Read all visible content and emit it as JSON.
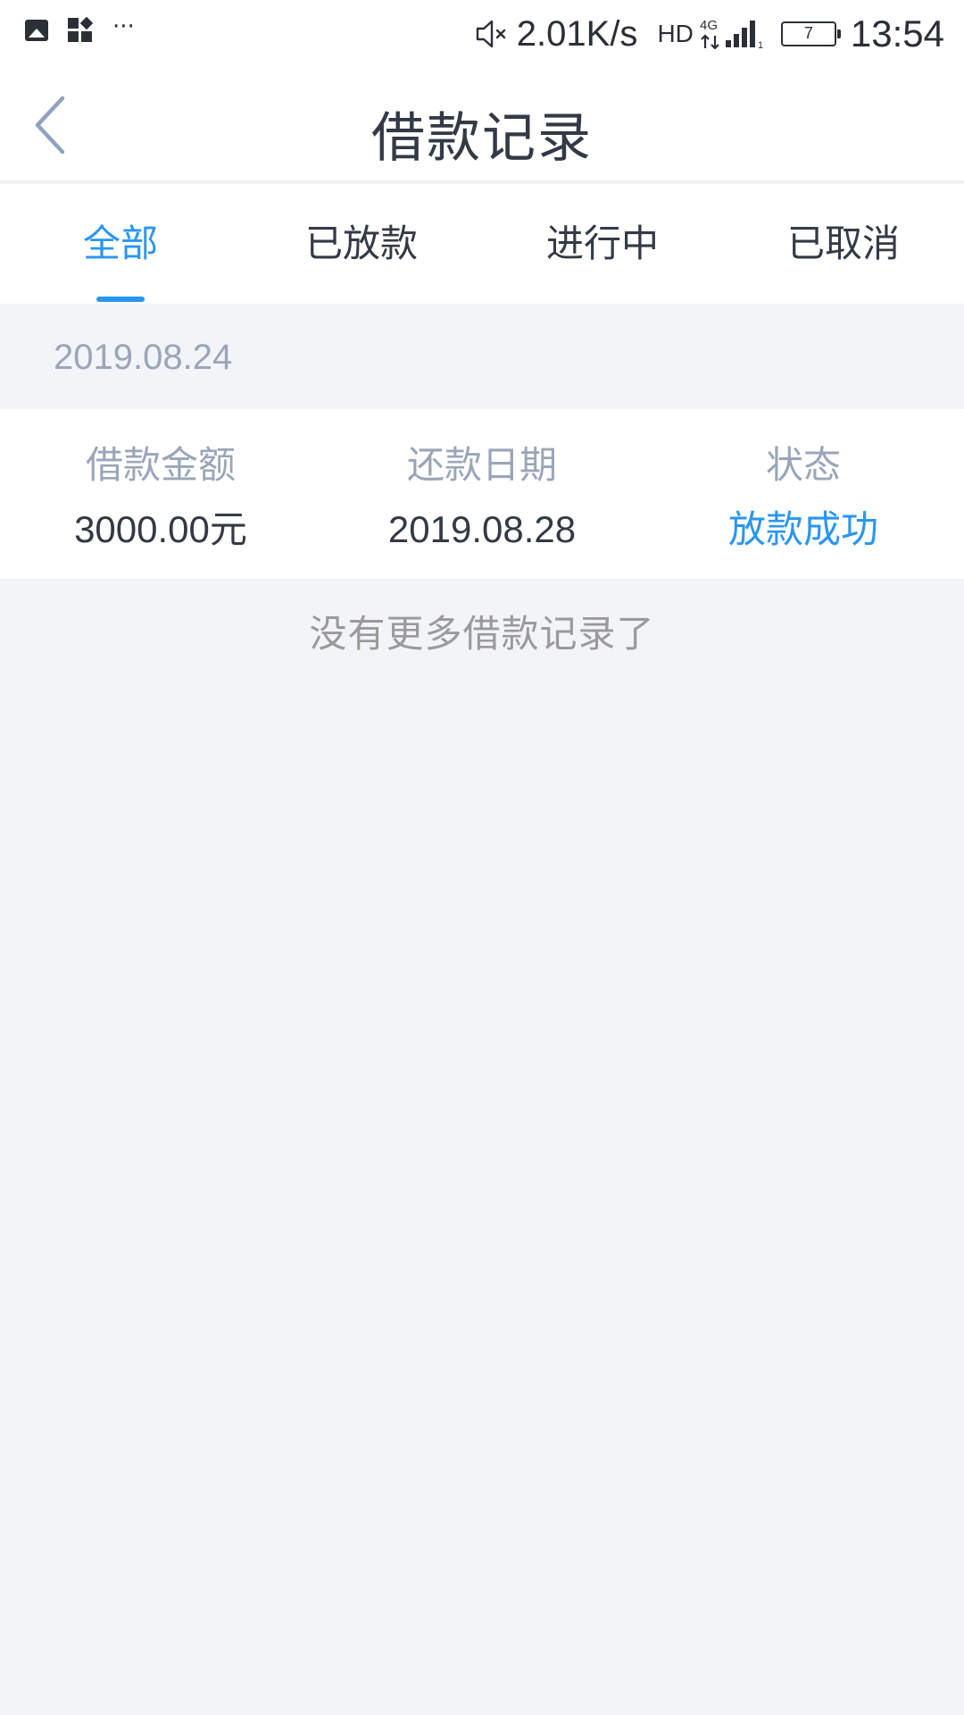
{
  "status_bar": {
    "icons_left": [
      "gallery-icon",
      "apps-icon"
    ],
    "overflow": "···",
    "mute_icon": "mute-icon",
    "net_speed": "2.01K/s",
    "hd": "HD",
    "network_type": "4G",
    "signal_icon": "signal-icon",
    "battery_level": "7",
    "time": "13:54"
  },
  "header": {
    "title": "借款记录",
    "back_icon": "chevron-left-icon"
  },
  "tabs": [
    {
      "label": "全部",
      "active": true
    },
    {
      "label": "已放款",
      "active": false
    },
    {
      "label": "进行中",
      "active": false
    },
    {
      "label": "已取消",
      "active": false
    }
  ],
  "records": [
    {
      "date": "2019.08.24",
      "columns": [
        {
          "label": "借款金额",
          "value": "3000.00元"
        },
        {
          "label": "还款日期",
          "value": "2019.08.28"
        },
        {
          "label": "状态",
          "value": "放款成功"
        }
      ]
    }
  ],
  "end_note": "没有更多借款记录了",
  "colors": {
    "accent": "#2a96f0",
    "title_text": "#333a45",
    "muted_text": "#9aa6b8",
    "background": "#f2f4f8"
  }
}
